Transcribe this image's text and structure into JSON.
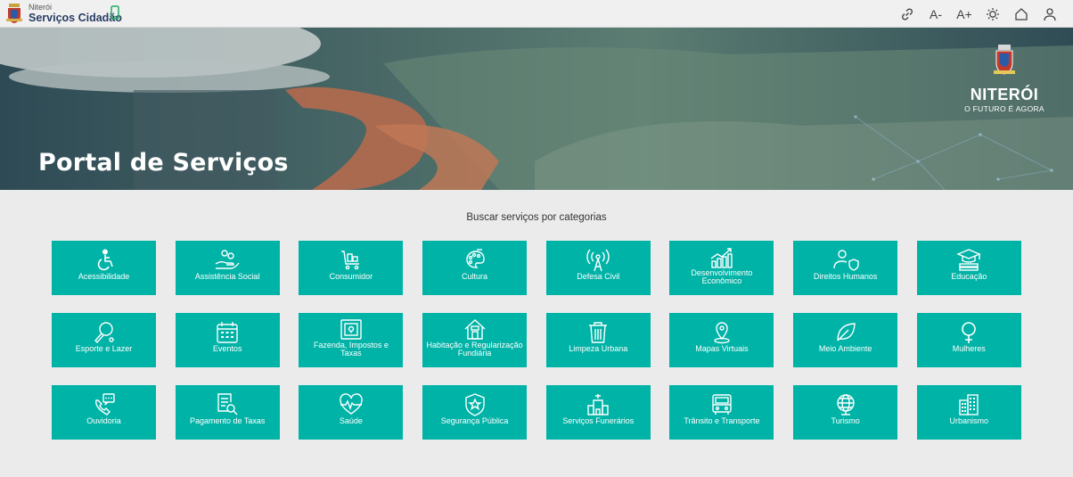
{
  "header": {
    "brand_small": "Niterói",
    "brand_title": "Serviços Cidadão",
    "tools": [
      {
        "name": "link-icon",
        "label": ""
      },
      {
        "name": "font-decrease",
        "label": "A-"
      },
      {
        "name": "font-increase",
        "label": "A+"
      },
      {
        "name": "contrast-icon",
        "label": ""
      },
      {
        "name": "home-icon",
        "label": ""
      },
      {
        "name": "user-icon",
        "label": ""
      }
    ]
  },
  "hero": {
    "title": "Portal de Serviços",
    "logo_name": "NITERÓI",
    "logo_tagline": "O FUTURO É AGORA"
  },
  "categories": {
    "heading": "Buscar serviços por categorias",
    "items": [
      {
        "label": "Acessibilidade",
        "icon": "accessibility-icon"
      },
      {
        "label": "Assistência Social",
        "icon": "social-assistance-icon"
      },
      {
        "label": "Consumidor",
        "icon": "shopping-cart-icon"
      },
      {
        "label": "Cultura",
        "icon": "palette-icon"
      },
      {
        "label": "Defesa Civil",
        "icon": "antenna-icon"
      },
      {
        "label": "Desenvolvimento Econômico",
        "icon": "growth-chart-icon"
      },
      {
        "label": "Direitos Humanos",
        "icon": "person-shield-icon"
      },
      {
        "label": "Educação",
        "icon": "graduation-cap-icon"
      },
      {
        "label": "Esporte e Lazer",
        "icon": "racket-icon"
      },
      {
        "label": "Eventos",
        "icon": "calendar-icon"
      },
      {
        "label": "Fazenda, Impostos e Taxas",
        "icon": "safe-icon"
      },
      {
        "label": "Habitação e Regularização Fundiária",
        "icon": "house-icon"
      },
      {
        "label": "Limpeza Urbana",
        "icon": "trash-icon"
      },
      {
        "label": "Mapas Virtuais",
        "icon": "map-pin-icon"
      },
      {
        "label": "Meio Ambiente",
        "icon": "leaf-icon"
      },
      {
        "label": "Mulheres",
        "icon": "female-icon"
      },
      {
        "label": "Ouvidoria",
        "icon": "phone-chat-icon"
      },
      {
        "label": "Pagamento de Taxas",
        "icon": "invoice-search-icon"
      },
      {
        "label": "Saúde",
        "icon": "heart-pulse-icon"
      },
      {
        "label": "Segurança Pública",
        "icon": "police-badge-icon"
      },
      {
        "label": "Serviços Funerários",
        "icon": "funeral-icon"
      },
      {
        "label": "Trânsito e Transporte",
        "icon": "bus-icon"
      },
      {
        "label": "Turismo",
        "icon": "globe-icon"
      },
      {
        "label": "Urbanismo",
        "icon": "buildings-icon"
      }
    ]
  }
}
